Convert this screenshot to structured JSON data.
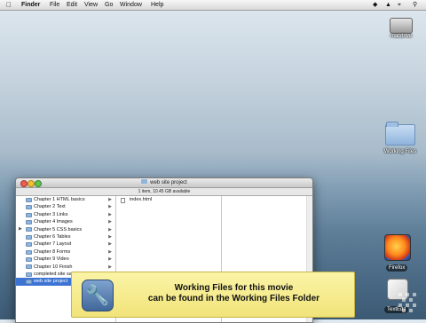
{
  "menubar": {
    "apple": "",
    "items": [
      "Finder",
      "File",
      "Edit",
      "View",
      "Go",
      "Window",
      "Help"
    ]
  },
  "desktop": {
    "hd_label": "macdrive",
    "folder_label": "Working Files"
  },
  "dock": {
    "firefox_label": "Firefox",
    "textedit_label": "TextEdit"
  },
  "window": {
    "title": "web site project",
    "status": "1 item, 10.45 GB available",
    "col1_items": [
      "Chapter 1 HTML basics",
      "Chapter 2 Text",
      "Chapter 3 Links",
      "Chapter 4 Images",
      "Chapter 5 CSS basics",
      "Chapter 6 Tables",
      "Chapter 7 Layout",
      "Chapter 8 Forms",
      "Chapter 9 Video",
      "Chapter 10 Finish",
      "completed site sample",
      "web site project"
    ],
    "col2_items": [
      "index.html"
    ]
  },
  "banner": {
    "line1": "Working Files for this movie",
    "line2": "can be found in the Working Files Folder"
  },
  "colors": {
    "selection": "#3d74d4",
    "banner_bg": "#f5ea8c"
  }
}
